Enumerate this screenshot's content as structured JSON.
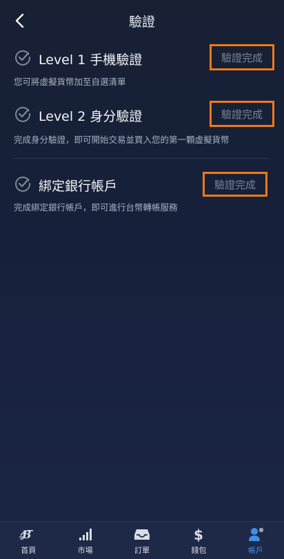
{
  "header": {
    "title": "驗證"
  },
  "items": [
    {
      "title": "Level 1 手機驗證",
      "desc": "您可將虛擬貨幣加至自選清單",
      "status": "驗證完成"
    },
    {
      "title": "Level 2 身分驗證",
      "desc": "完成身分驗證，即可開始交易並買入您的第一顆虛擬貨幣",
      "status": "驗證完成"
    },
    {
      "title": "綁定銀行帳戶",
      "desc": "完成綁定銀行帳戶，即可進行台幣轉帳服務",
      "status": "驗證完成"
    }
  ],
  "tabbar": {
    "tabs": [
      {
        "label": "首頁",
        "icon": "home-logo-icon"
      },
      {
        "label": "市場",
        "icon": "signal-bars-icon"
      },
      {
        "label": "訂單",
        "icon": "inbox-tray-icon"
      },
      {
        "label": "錢包",
        "icon": "dollar-sign-icon"
      },
      {
        "label": "帳戶",
        "icon": "user-icon"
      }
    ],
    "active_index": 4
  },
  "colors": {
    "accent": "#3f8fe8",
    "highlight_border": "#ef7a18",
    "status_text": "#7a8497"
  }
}
